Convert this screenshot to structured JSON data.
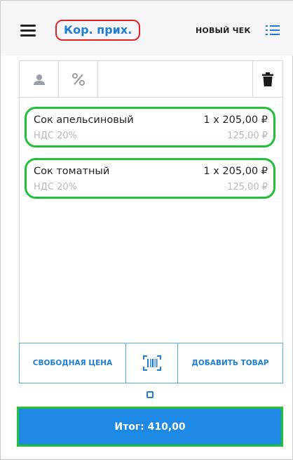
{
  "header": {
    "title": "Кор. прих.",
    "new_check_label": "НОВЫЙ ЧЕК"
  },
  "toolbar": {
    "icons": [
      "user-icon",
      "percent-icon",
      "trash-icon"
    ]
  },
  "items": [
    {
      "name": "Сок апельсиновый",
      "qty_price": "1 x 205,00 ₽",
      "vat": "НДС 20%",
      "sum": "125,00 ₽"
    },
    {
      "name": "Сок томатный",
      "qty_price": "1 x 205,00 ₽",
      "vat": "НДС 20%",
      "sum": "125,00 ₽"
    }
  ],
  "actions": {
    "free_price_label": "СВОБОДНАЯ ЦЕНА",
    "add_item_label": "ДОБАВИТЬ ТОВАР"
  },
  "total": {
    "label": "Итог: 410,00"
  },
  "colors": {
    "accent_blue": "#1e88e5",
    "highlight_green": "#22c039",
    "highlight_red": "#e02424"
  }
}
